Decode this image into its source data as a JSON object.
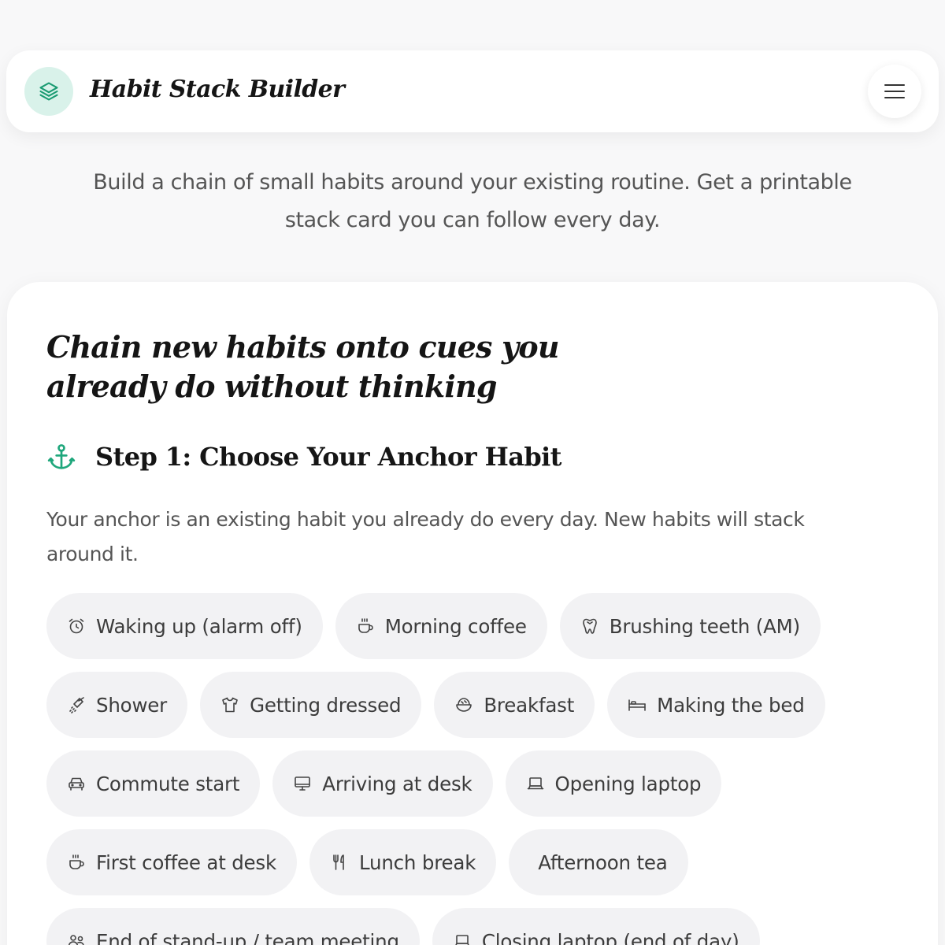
{
  "app": {
    "title": "Habit Stack Builder"
  },
  "header": {
    "logo_icon": "layers-icon",
    "menu_icon": "hamburger-menu-icon"
  },
  "tagline": "Build a chain of small habits around your existing routine. Get a printable stack card you can follow every day.",
  "card": {
    "headline": "Chain new habits onto cues you already do without thinking",
    "step": {
      "icon": "anchor-icon",
      "title": "Step 1: Choose Your Anchor Habit",
      "description": "Your anchor is an existing habit you already do every day. New habits will stack around it."
    },
    "chips": [
      {
        "label": "Waking up (alarm off)",
        "icon": "alarm-clock-icon"
      },
      {
        "label": "Morning coffee",
        "icon": "coffee-cup-icon"
      },
      {
        "label": "Brushing teeth (AM)",
        "icon": "tooth-icon"
      },
      {
        "label": "Shower",
        "icon": "shower-icon"
      },
      {
        "label": "Getting dressed",
        "icon": "shirt-icon"
      },
      {
        "label": "Breakfast",
        "icon": "bowl-icon"
      },
      {
        "label": "Making the bed",
        "icon": "bed-icon"
      },
      {
        "label": "Commute start",
        "icon": "car-icon"
      },
      {
        "label": "Arriving at desk",
        "icon": "monitor-icon"
      },
      {
        "label": "Opening laptop",
        "icon": "laptop-icon"
      },
      {
        "label": "First coffee at desk",
        "icon": "coffee-cup-icon"
      },
      {
        "label": "Lunch break",
        "icon": "utensils-icon"
      },
      {
        "label": "Afternoon tea",
        "icon": ""
      },
      {
        "label": "End of stand-up / team meeting",
        "icon": "users-icon"
      },
      {
        "label": "Closing laptop (end of day)",
        "icon": "laptop-icon"
      }
    ]
  },
  "colors": {
    "accent": "#1fa77c",
    "accent_bg": "#d9f2ea",
    "chip_bg": "#f2f2f4",
    "page_bg": "#f8f8f9"
  }
}
